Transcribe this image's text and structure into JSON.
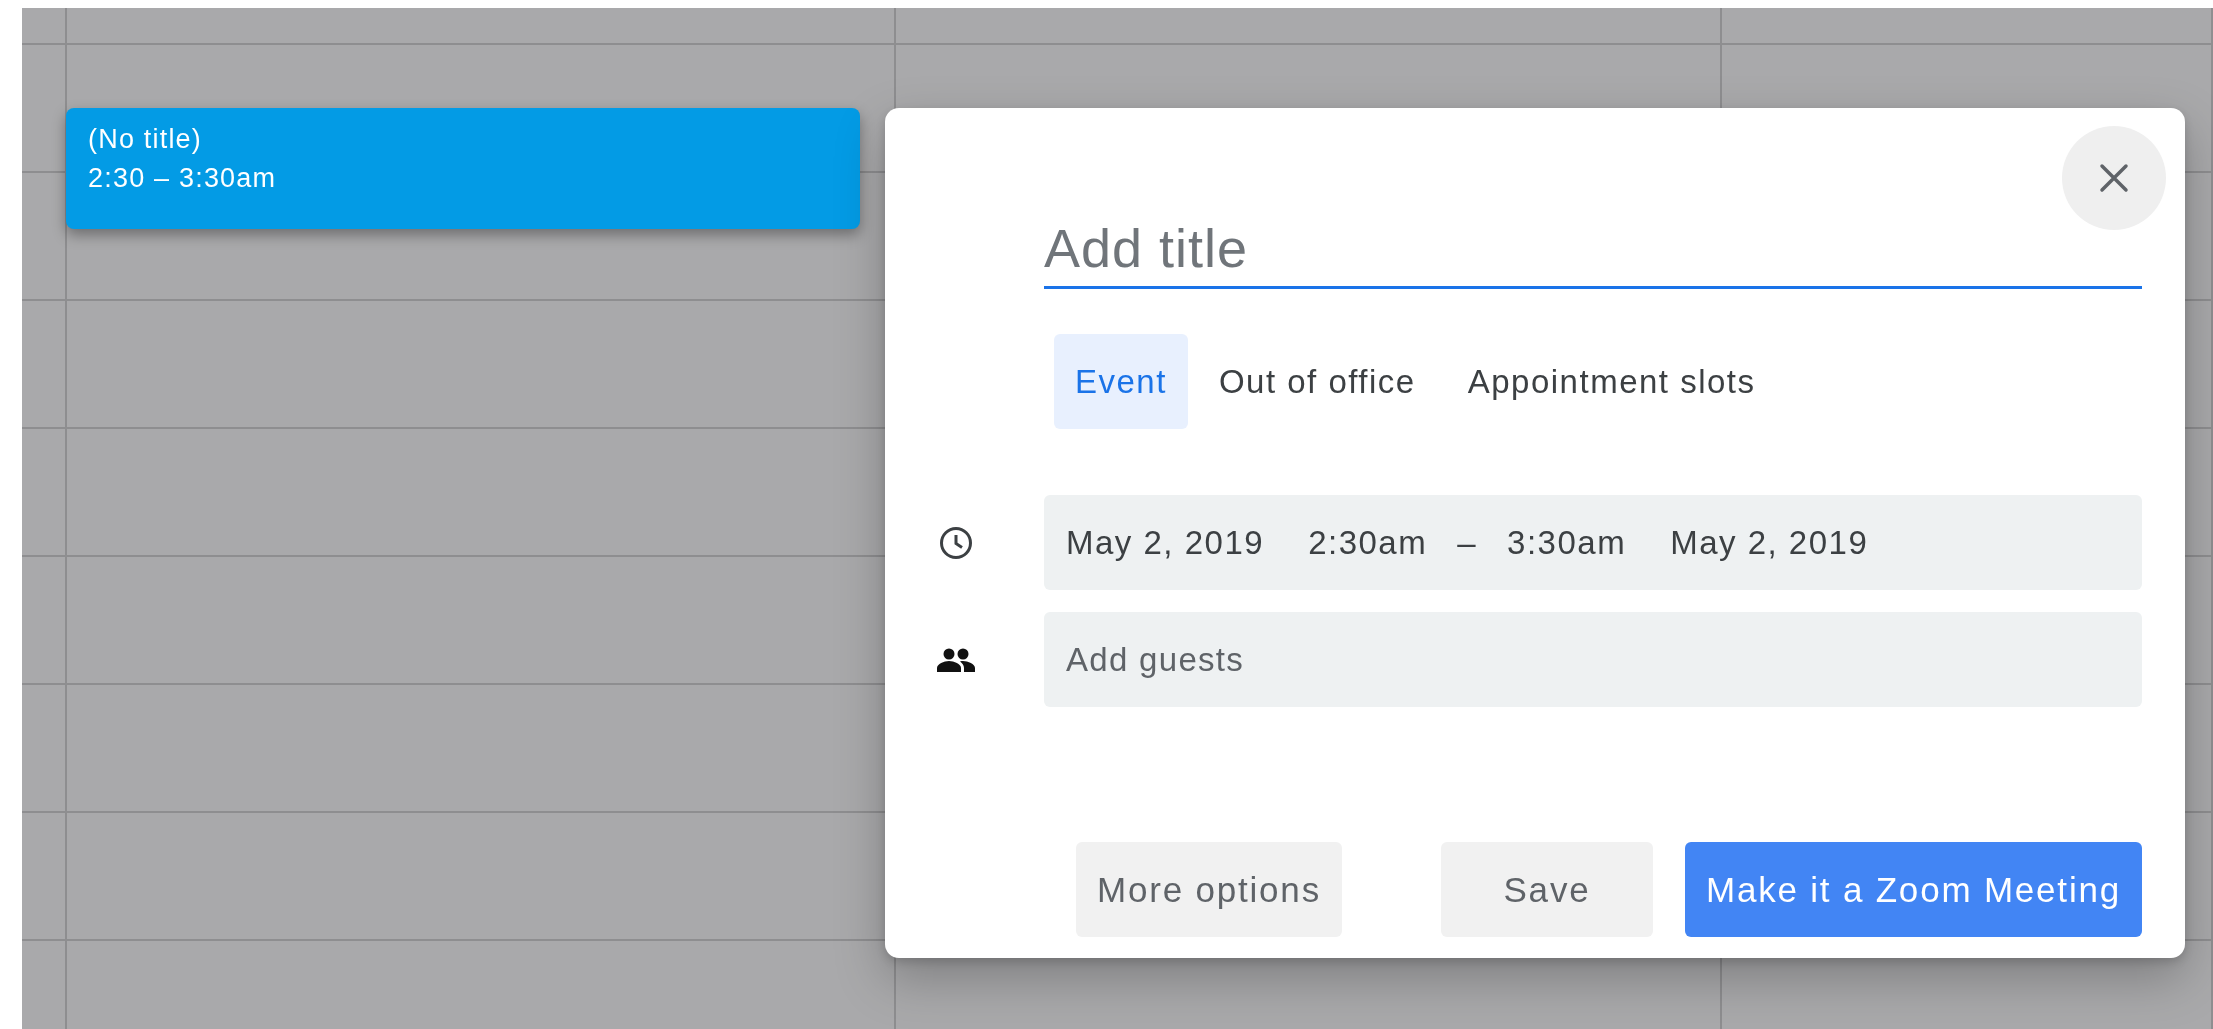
{
  "calendar": {
    "event": {
      "title": "(No title)",
      "time": "2:30 – 3:30am",
      "selected": true
    }
  },
  "dialog": {
    "title_field": {
      "placeholder": "Add title",
      "focused": true
    },
    "tabs": [
      {
        "label": "Event",
        "selected": true
      },
      {
        "label": "Out of office",
        "selected": false
      },
      {
        "label": "Appointment slots",
        "selected": false
      }
    ],
    "date_time": {
      "start_date": "May 2, 2019",
      "start_time": "2:30am",
      "separator": "–",
      "end_time": "3:30am",
      "end_date": "May 2, 2019"
    },
    "guests": {
      "placeholder": "Add guests"
    },
    "buttons": [
      {
        "label": "More options",
        "kind": "secondary"
      },
      {
        "label": "Save",
        "kind": "secondary"
      },
      {
        "label": "Make it a Zoom Meeting",
        "kind": "primary"
      }
    ]
  }
}
